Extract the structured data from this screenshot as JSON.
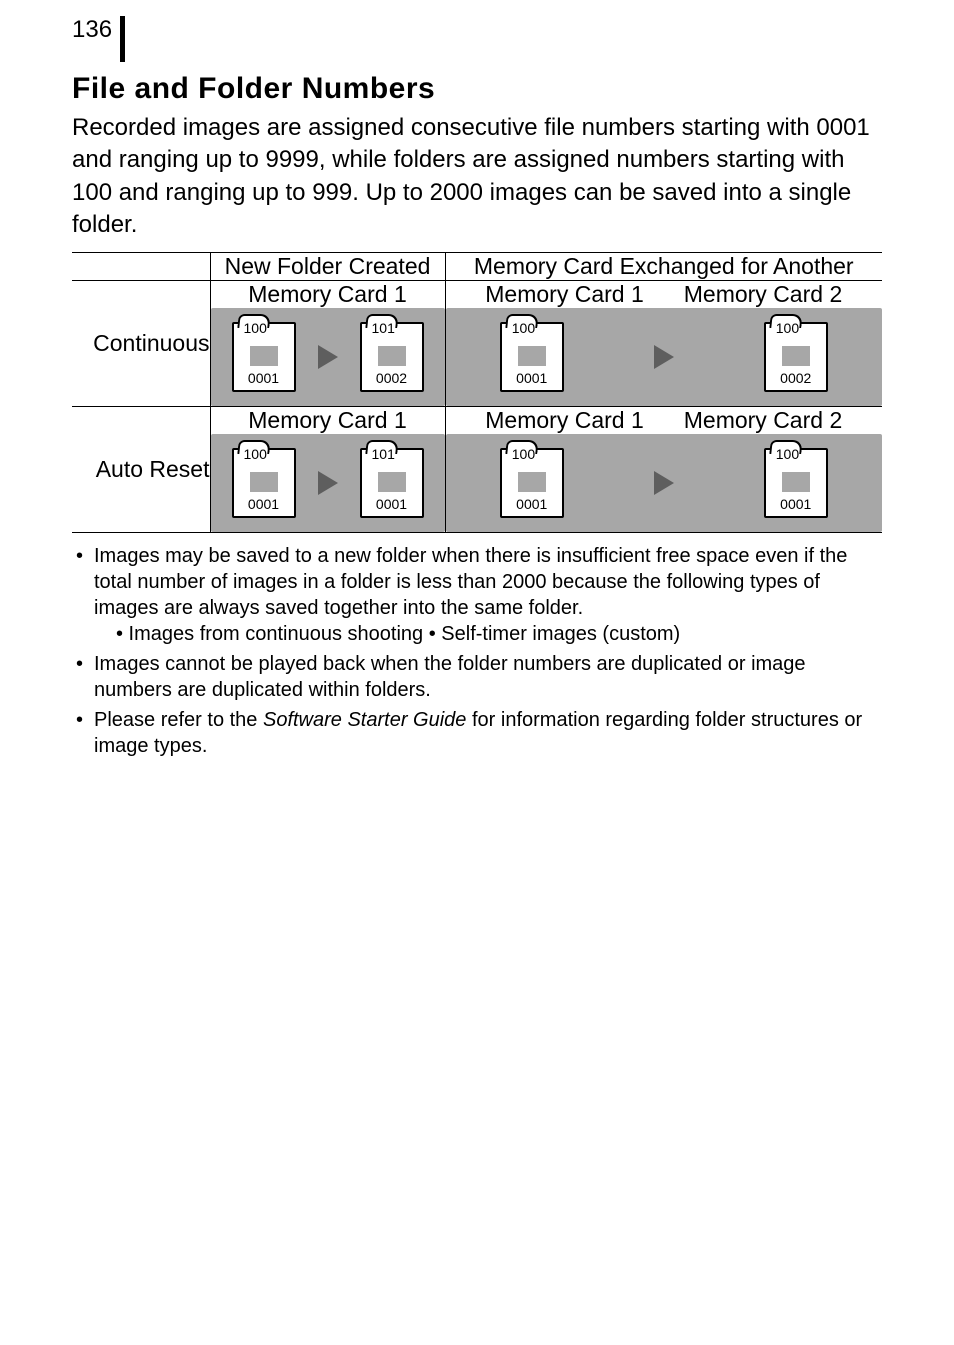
{
  "page_number": "136",
  "title": "File and Folder Numbers",
  "intro": "Recorded images are assigned consecutive file numbers starting with 0001 and ranging up to 9999, while folders are assigned numbers starting with 100 and ranging up to 999. Up to 2000 images can be saved into a single folder.",
  "table": {
    "col_headers": {
      "new_folder": "New Folder Created",
      "exchanged": "Memory Card Exchanged for Another"
    },
    "card_labels": {
      "card1": "Memory Card 1",
      "card2": "Memory Card 2"
    },
    "rows": {
      "continuous": {
        "label": "Continuous",
        "new_folder": [
          {
            "folder": "100",
            "image": "0001"
          },
          {
            "folder": "101",
            "image": "0002"
          }
        ],
        "exchanged": [
          {
            "folder": "100",
            "image": "0001"
          },
          {
            "folder": "100",
            "image": "0002"
          }
        ]
      },
      "auto_reset": {
        "label": "Auto Reset",
        "new_folder": [
          {
            "folder": "100",
            "image": "0001"
          },
          {
            "folder": "101",
            "image": "0001"
          }
        ],
        "exchanged": [
          {
            "folder": "100",
            "image": "0001"
          },
          {
            "folder": "100",
            "image": "0001"
          }
        ]
      }
    }
  },
  "notes": {
    "n1": "Images may be saved to a new folder when there is insufficient free space even if the total number of images in a folder is less than 2000 because the following types of images are always saved together into the same folder.",
    "n1_sub": "• Images from continuous shooting   • Self-timer images (custom)",
    "n2": "Images cannot be played back when the folder numbers are duplicated or image numbers are duplicated within folders.",
    "n3_a": "Please refer to the ",
    "n3_b": "Software Starter Guide",
    "n3_c": " for information regarding folder structures or image types."
  }
}
